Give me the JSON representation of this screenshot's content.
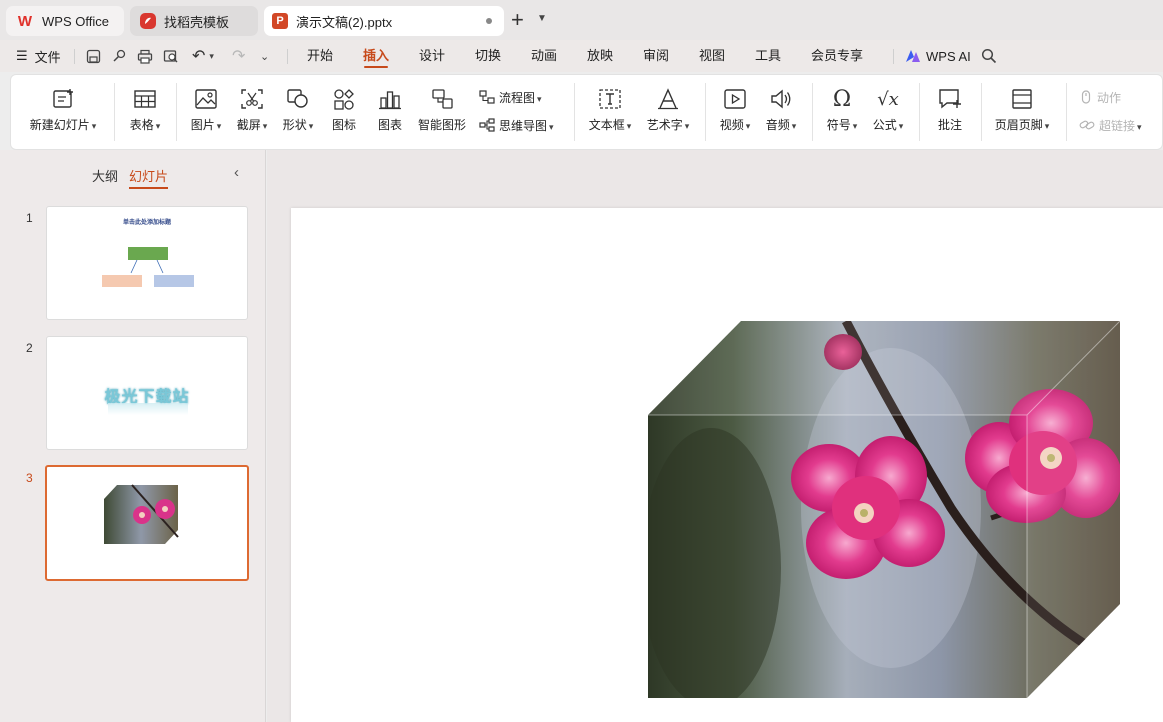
{
  "tabs": [
    {
      "label": "WPS Office"
    },
    {
      "label": "找稻壳模板"
    },
    {
      "label": "演示文稿(2).pptx"
    }
  ],
  "menubar": {
    "file_label": "文件",
    "tabs": [
      {
        "label": "开始"
      },
      {
        "label": "插入"
      },
      {
        "label": "设计"
      },
      {
        "label": "切换"
      },
      {
        "label": "动画"
      },
      {
        "label": "放映"
      },
      {
        "label": "审阅"
      },
      {
        "label": "视图"
      },
      {
        "label": "工具"
      },
      {
        "label": "会员专享"
      }
    ],
    "active_tab": "插入",
    "wps_ai_label": "WPS AI"
  },
  "ribbon": {
    "new_slide": "新建幻灯片",
    "table": "表格",
    "picture": "图片",
    "screenshot": "截屏",
    "shape": "形状",
    "icon": "图标",
    "chart": "图表",
    "smartart": "智能图形",
    "flowchart": "流程图",
    "mindmap": "思维导图",
    "textbox": "文本框",
    "wordart": "艺术字",
    "video": "视频",
    "audio": "音频",
    "symbol": "符号",
    "formula": "公式",
    "comment": "批注",
    "header_footer": "页眉页脚",
    "action": "动作",
    "hyperlink": "超链接"
  },
  "left_pane": {
    "tab_outline": "大纲",
    "tab_slides": "幻灯片",
    "slides": [
      {
        "number": "1",
        "title": "单击此处添加标题"
      },
      {
        "number": "2",
        "text": "极光下载站"
      },
      {
        "number": "3"
      }
    ],
    "active_slide": "3"
  },
  "colors": {
    "accent": "#c74a1b",
    "thumb_active_border": "#dd6a32",
    "blossom": "#e0307d"
  }
}
